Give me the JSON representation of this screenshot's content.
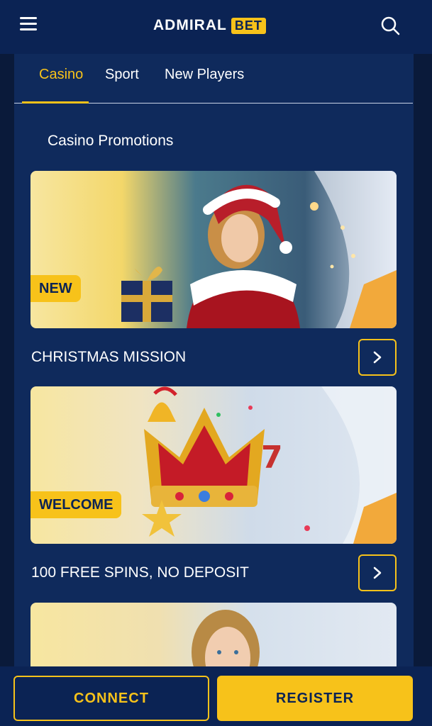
{
  "header": {
    "logo_main": "ADMIRAL",
    "logo_accent": "BET",
    "menu_icon": "hamburger-menu-icon",
    "search_icon": "search-icon"
  },
  "tabs": [
    {
      "label": "Casino",
      "active": true
    },
    {
      "label": "Sport",
      "active": false
    },
    {
      "label": "New Players",
      "active": false
    }
  ],
  "section": {
    "title": "Casino Promotions"
  },
  "promotions": [
    {
      "badge": "NEW",
      "title": "CHRISTMAS MISSION"
    },
    {
      "badge": "WELCOME",
      "title": "100 FREE SPINS, NO DEPOSIT"
    },
    {
      "badge": "",
      "title": ""
    }
  ],
  "footer": {
    "connect_label": "CONNECT",
    "register_label": "REGISTER"
  },
  "colors": {
    "accent": "#f7c21a",
    "background": "#0f2a5c",
    "header": "#0b2354"
  }
}
